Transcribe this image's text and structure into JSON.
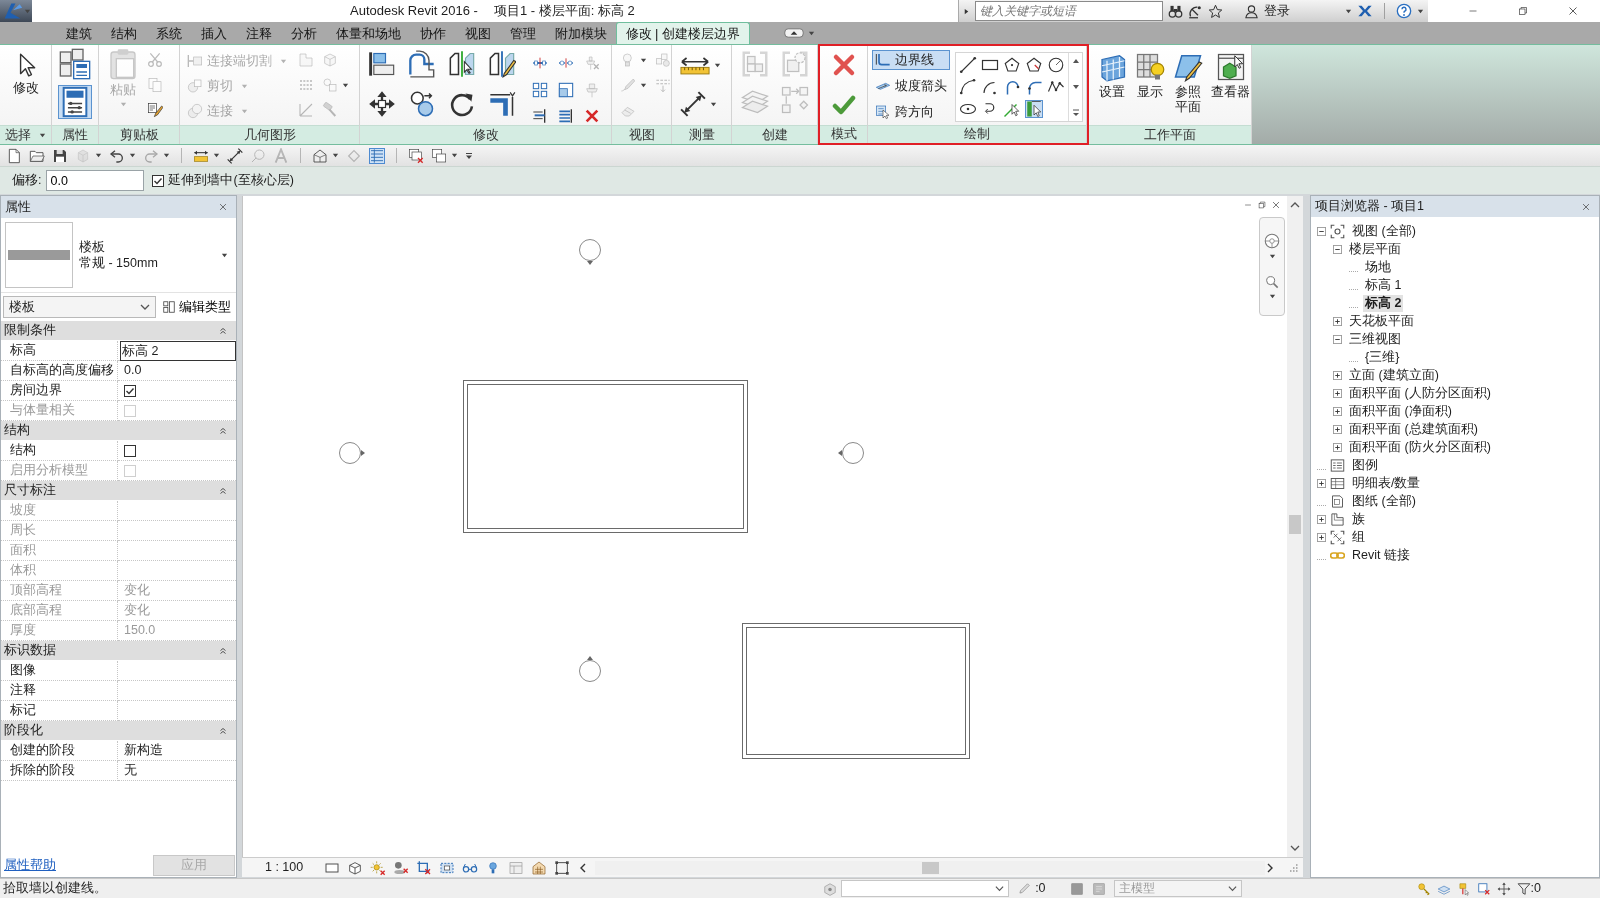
{
  "title_bar": {
    "app": "Autodesk Revit 2016 -",
    "document": "项目1 - 楼层平面: 标高 2",
    "search": {
      "placeholder": "键入关键字或短语"
    },
    "sign_in": "登录"
  },
  "ribbon": {
    "tabs": [
      {
        "label": "建筑",
        "selected": false
      },
      {
        "label": "结构",
        "selected": false
      },
      {
        "label": "系统",
        "selected": false
      },
      {
        "label": "插入",
        "selected": false
      },
      {
        "label": "注释",
        "selected": false
      },
      {
        "label": "分析",
        "selected": false
      },
      {
        "label": "体量和场地",
        "selected": false
      },
      {
        "label": "协作",
        "selected": false
      },
      {
        "label": "视图",
        "selected": false
      },
      {
        "label": "管理",
        "selected": false
      },
      {
        "label": "附加模块",
        "selected": false
      },
      {
        "label": "修改 | 创建楼层边界",
        "selected": true
      }
    ],
    "panels": [
      {
        "label": "选择",
        "highlighted": false,
        "tools": [
          {
            "label": "修改",
            "disabled": false
          }
        ]
      },
      {
        "label": "属性",
        "highlighted": false,
        "tools": [
          {
            "disabled": false,
            "selected": false
          },
          {
            "disabled": false,
            "selected": true
          }
        ]
      },
      {
        "label": "剪贴板",
        "highlighted": false,
        "tools": [
          {
            "label": "粘贴",
            "disabled": true
          },
          {
            "disabled": true
          },
          {
            "disabled": true
          },
          {
            "disabled": false
          }
        ]
      },
      {
        "label": "几何图形",
        "highlighted": false,
        "tools": [
          {
            "label": "连接端切割",
            "disabled": true
          },
          {
            "label": "剪切",
            "disabled": true
          },
          {
            "label": "连接",
            "disabled": true
          },
          {
            "disabled": true
          },
          {
            "disabled": true
          },
          {
            "disabled": true
          },
          {
            "disabled": true
          },
          {
            "disabled": true
          },
          {
            "disabled": true
          }
        ]
      },
      {
        "label": "修改",
        "highlighted": false,
        "tools": [
          {
            "disabled": false
          },
          {
            "disabled": false
          },
          {
            "disabled": false
          },
          {
            "disabled": false
          },
          {
            "disabled": false
          },
          {
            "disabled": false
          },
          {
            "disabled": false
          },
          {
            "disabled": false
          },
          {
            "disabled": false
          },
          {
            "disabled": false
          },
          {
            "disabled": true
          },
          {
            "disabled": false
          },
          {
            "disabled": false
          },
          {
            "disabled": true
          },
          {
            "disabled": false
          },
          {
            "disabled": false
          },
          {
            "disabled": false
          }
        ]
      },
      {
        "label": "视图",
        "highlighted": false,
        "tools": [
          {
            "disabled": true
          },
          {
            "disabled": true
          },
          {
            "disabled": true
          },
          {
            "disabled": true
          },
          {
            "disabled": true
          }
        ]
      },
      {
        "label": "测量",
        "highlighted": false,
        "tools": [
          {
            "disabled": false
          },
          {
            "disabled": false
          }
        ]
      },
      {
        "label": "创建",
        "highlighted": false,
        "tools": [
          {
            "disabled": true
          },
          {
            "disabled": true
          },
          {
            "disabled": true
          },
          {
            "disabled": true
          }
        ]
      },
      {
        "label": "模式",
        "highlighted": true,
        "tools": [
          {
            "disabled": false
          },
          {
            "disabled": false
          }
        ]
      },
      {
        "label": "绘制",
        "highlighted": true,
        "tools": [
          {
            "label": "边界线",
            "disabled": false,
            "selected": true
          },
          {
            "label": "坡度箭头",
            "disabled": false,
            "selected": false
          },
          {
            "label": "跨方向",
            "disabled": false,
            "selected": false
          }
        ],
        "shapes": [
          {
            "selected": false
          },
          {
            "selected": false
          },
          {
            "selected": false
          },
          {
            "selected": false
          },
          {
            "selected": false
          },
          {
            "selected": false
          },
          {
            "selected": false
          },
          {
            "selected": false
          },
          {
            "selected": false
          },
          {
            "selected": false
          },
          {
            "selected": false
          },
          {
            "selected": false
          },
          {
            "selected": false
          },
          {
            "selected": true
          }
        ]
      },
      {
        "label": "工作平面",
        "highlighted": false,
        "tools": [
          {
            "label": "设置",
            "disabled": false
          },
          {
            "label": "显示",
            "disabled": false
          },
          {
            "label": "参照平面",
            "disabled": false
          },
          {
            "label": "查看器",
            "disabled": false
          }
        ]
      }
    ]
  },
  "quick_access": [
    {
      "disabled": false,
      "on": false
    },
    {
      "disabled": false,
      "on": false
    },
    {
      "disabled": false,
      "on": false
    },
    {
      "disabled": true,
      "on": false
    },
    {
      "disabled": false,
      "on": false
    },
    {
      "disabled": true,
      "on": false
    },
    {
      "disabled": false,
      "on": false
    },
    {
      "disabled": false,
      "on": false
    },
    {
      "disabled": true,
      "on": false
    },
    {
      "disabled": true,
      "on": false
    },
    {
      "disabled": false,
      "on": false
    },
    {
      "disabled": true,
      "on": false
    },
    {
      "disabled": false,
      "on": true
    },
    {
      "disabled": false,
      "on": false
    },
    {
      "disabled": false,
      "on": false
    },
    {
      "disabled": false,
      "on": false
    }
  ],
  "options_bar": {
    "offset": {
      "label": "偏移:",
      "value": "0.0"
    },
    "extend": {
      "label": "延伸到墙中(至核心层)",
      "checked": true
    }
  },
  "properties": {
    "title": "属性",
    "type": {
      "family": "楼板",
      "name": "常规 - 150mm"
    },
    "filter": "楼板",
    "edit_type": "编辑类型",
    "groups": [
      {
        "label": "限制条件",
        "expanded": true,
        "rows": [
          {
            "name": "标高",
            "kind": "input",
            "value": "标高 2",
            "disabled": false
          },
          {
            "name": "自标高的高度偏移",
            "kind": "text",
            "value": "0.0",
            "disabled": false
          },
          {
            "name": "房间边界",
            "kind": "checkbox",
            "checked": true,
            "disabled": false
          },
          {
            "name": "与体量相关",
            "kind": "checkbox",
            "checked": false,
            "disabled": true
          }
        ]
      },
      {
        "label": "结构",
        "expanded": true,
        "rows": [
          {
            "name": "结构",
            "kind": "checkbox",
            "checked": false,
            "disabled": false
          },
          {
            "name": "启用分析模型",
            "kind": "checkbox",
            "checked": false,
            "disabled": true
          }
        ]
      },
      {
        "label": "尺寸标注",
        "expanded": true,
        "rows": [
          {
            "name": "坡度",
            "kind": "text",
            "disabled": true
          },
          {
            "name": "周长",
            "kind": "text",
            "disabled": true
          },
          {
            "name": "面积",
            "kind": "text",
            "disabled": true
          },
          {
            "name": "体积",
            "kind": "text",
            "disabled": true
          },
          {
            "name": "顶部高程",
            "kind": "text",
            "value": "变化",
            "disabled": true
          },
          {
            "name": "底部高程",
            "kind": "text",
            "value": "变化",
            "disabled": true
          },
          {
            "name": "厚度",
            "kind": "text",
            "value": "150.0",
            "disabled": true
          }
        ]
      },
      {
        "label": "标识数据",
        "expanded": true,
        "rows": [
          {
            "name": "图像",
            "kind": "text",
            "disabled": false
          },
          {
            "name": "注释",
            "kind": "text",
            "disabled": false
          },
          {
            "name": "标记",
            "kind": "text",
            "disabled": false
          }
        ]
      },
      {
        "label": "阶段化",
        "expanded": true,
        "rows": [
          {
            "name": "创建的阶段",
            "kind": "text",
            "value": "新构造",
            "disabled": false
          },
          {
            "name": "拆除的阶段",
            "kind": "text",
            "value": "无",
            "disabled": false
          }
        ]
      }
    ],
    "help": "属性帮助",
    "apply": {
      "label": "应用",
      "disabled": true
    }
  },
  "view": {
    "scale": "1 : 100"
  },
  "project_browser": {
    "title": "项目浏览器 - 项目1",
    "tree": [
      {
        "label": "视图 (全部)",
        "expanded": true,
        "selected": false,
        "children": [
          {
            "label": "楼层平面",
            "expanded": true,
            "selected": false,
            "children": [
              {
                "label": "场地",
                "selected": false
              },
              {
                "label": "标高 1",
                "selected": false
              },
              {
                "label": "标高 2",
                "selected": true
              }
            ]
          },
          {
            "label": "天花板平面",
            "expanded": false,
            "selected": false
          },
          {
            "label": "三维视图",
            "expanded": true,
            "selected": false,
            "children": [
              {
                "label": "{三维}",
                "selected": false
              }
            ]
          },
          {
            "label": "立面 (建筑立面)",
            "expanded": false,
            "selected": false
          },
          {
            "label": "面积平面 (人防分区面积)",
            "expanded": false,
            "selected": false
          },
          {
            "label": "面积平面 (净面积)",
            "expanded": false,
            "selected": false
          },
          {
            "label": "面积平面 (总建筑面积)",
            "expanded": false,
            "selected": false
          },
          {
            "label": "面积平面 (防火分区面积)",
            "expanded": false,
            "selected": false
          }
        ]
      },
      {
        "label": "图例",
        "selected": false
      },
      {
        "label": "明细表/数量",
        "expanded": false,
        "selected": false
      },
      {
        "label": "图纸 (全部)",
        "selected": false
      },
      {
        "label": "族",
        "expanded": false,
        "selected": false
      },
      {
        "label": "组",
        "expanded": false,
        "selected": false
      },
      {
        "label": "Revit 链接",
        "selected": false
      }
    ]
  },
  "status_bar": {
    "message": "拾取墙以创建线。",
    "editable_count": ":0",
    "model": {
      "value": "主模型",
      "disabled": true
    },
    "filter_count": ":0"
  }
}
